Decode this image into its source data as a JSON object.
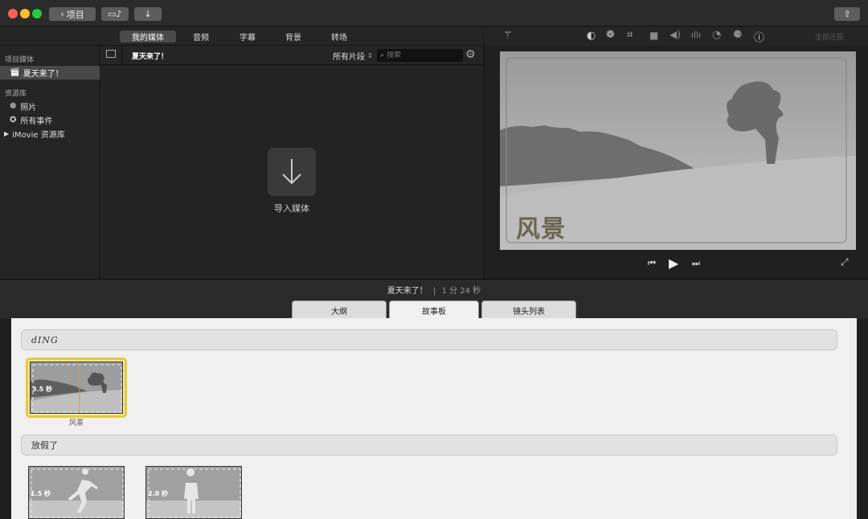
{
  "window": {
    "traffic": [
      "#fe5f57",
      "#febc2e",
      "#28c840"
    ]
  },
  "toolbar": {
    "back_label": "项目"
  },
  "media_tabs": [
    "我的媒体",
    "音频",
    "字幕",
    "背景",
    "转场"
  ],
  "sidebar": {
    "section_project": "项目媒体",
    "project_item": "夏天来了！",
    "section_library": "资源库",
    "library_items": [
      "照片",
      "所有事件"
    ],
    "imovie_library": "iMovie 资源库"
  },
  "browser": {
    "title": "夏天来了！",
    "filter_label": "所有片段",
    "search_placeholder": "搜索",
    "import_label": "导入媒体"
  },
  "viewer": {
    "reset_label": "全部还原",
    "preview_title": "风景"
  },
  "timeline": {
    "title": "夏天来了！",
    "duration": "1 分 24 秒"
  },
  "storyboard": {
    "tabs": [
      "大纲",
      "故事板",
      "镜头列表"
    ],
    "groups": [
      {
        "name": "dING",
        "clips": [
          {
            "duration": "3.5 秒",
            "label": "风景"
          }
        ]
      },
      {
        "name": "放假了",
        "clips": [
          {
            "duration": "1.5 秒"
          },
          {
            "duration": "2.0 秒"
          }
        ]
      }
    ]
  }
}
